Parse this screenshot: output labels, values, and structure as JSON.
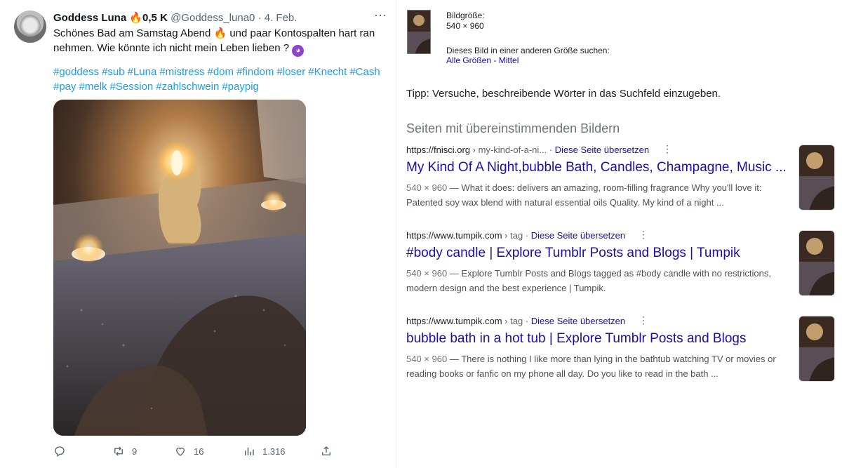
{
  "tweet": {
    "display_name": "Goddess Luna",
    "name_suffix": "0,5 K",
    "handle": "@Goddess_luna0",
    "separator": "·",
    "date": "4. Feb.",
    "text_part1": "Schönes Bad am Samstag Abend",
    "text_part2": "und paar Kontospalten hart ran nehmen. Wie könnte ich nicht mein Leben lieben ?",
    "hashtags": [
      "#goddess",
      "#sub",
      "#Luna",
      "#mistress",
      "#dom",
      "#findom",
      "#loser",
      "#Knecht",
      "#Cash",
      "#pay",
      "#melk",
      "#Session",
      "#zahlschwein",
      "#paypig"
    ],
    "actions": {
      "reply_count": "",
      "retweet_count": "9",
      "like_count": "16",
      "views_count": "1.316"
    },
    "icons": {
      "fire": "fire-emoji-icon",
      "devil": "smiling-devil-emoji-icon",
      "more": "more-options-icon",
      "reply": "reply-icon",
      "retweet": "retweet-icon",
      "like": "heart-icon",
      "views": "views-chart-icon",
      "share": "share-icon"
    }
  },
  "search": {
    "image_size_label": "Bildgröße:",
    "image_size_value": "540 × 960",
    "other_sizes_label": "Dieses Bild in einer anderen Größe suchen:",
    "size_link_all": "Alle Größen",
    "size_link_sep": " - ",
    "size_link_medium": "Mittel",
    "tip": "Tipp: Versuche, beschreibende Wörter in das Suchfeld einzugeben.",
    "section_title": "Seiten mit übereinstimmenden Bildern",
    "results": [
      {
        "site": "https://fnisci.org",
        "path": " › my-kind-of-a-ni... · ",
        "translate": "Diese Seite übersetzen",
        "title": "My Kind Of A Night,bubble Bath, Candles, Champagne, Music ...",
        "dims": "540 × 960",
        "snippet": " — What it does: delivers an amazing, room-filling fragrance Why you'll love it: Patented soy wax blend with natural essential oils Quality. My kind of a night ..."
      },
      {
        "site": "https://www.tumpik.com",
        "path": " › tag · ",
        "translate": "Diese Seite übersetzen",
        "title": "#body candle | Explore Tumblr Posts and Blogs | Tumpik",
        "dims": "540 × 960",
        "snippet": " — Explore Tumblr Posts and Blogs tagged as #body candle with no restrictions, modern design and the best experience | Tumpik."
      },
      {
        "site": "https://www.tumpik.com",
        "path": " › tag · ",
        "translate": "Diese Seite übersetzen",
        "title": "bubble bath in a hot tub | Explore Tumblr Posts and Blogs",
        "dims": "540 × 960",
        "snippet": " — There is nothing I like more than lying in the bathtub watching TV or movies or reading books or fanfic on my phone all day. Do you like to read in the bath ..."
      }
    ]
  }
}
